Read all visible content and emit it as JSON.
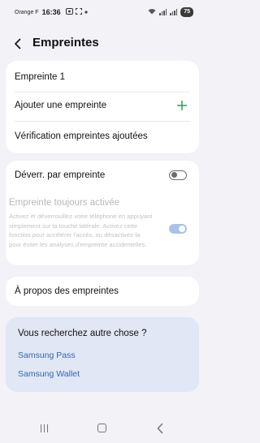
{
  "status_bar": {
    "carrier": "Orange F",
    "time": "16:36",
    "battery": "75"
  },
  "header": {
    "title": "Empreintes"
  },
  "fingerprints_card": {
    "items": [
      {
        "label": "Empreinte 1"
      },
      {
        "label": "Ajouter une empreinte"
      },
      {
        "label": "Vérification empreintes ajoutées"
      }
    ]
  },
  "unlock_card": {
    "unlock_label": "Déverr. par empreinte",
    "unlock_enabled": false,
    "always_on_title": "Empreinte toujours activée",
    "always_on_description": "Activez et déverrouillez votre téléphone en appuyant simplement sur la touche latérale. Activez cette fonction pour accélérer l'accès, ou désactivez-la pour éviter les analyses d'empreinte accidentelles.",
    "always_on_enabled": true
  },
  "about_card": {
    "label": "À propos des empreintes"
  },
  "suggestions": {
    "title": "Vous recherchez autre chose ?",
    "links": [
      {
        "label": "Samsung Pass"
      },
      {
        "label": "Samsung Wallet"
      }
    ]
  },
  "colors": {
    "accent_green": "#2e9d5f",
    "link_blue": "#3767b0",
    "background": "#f2f2f7"
  }
}
